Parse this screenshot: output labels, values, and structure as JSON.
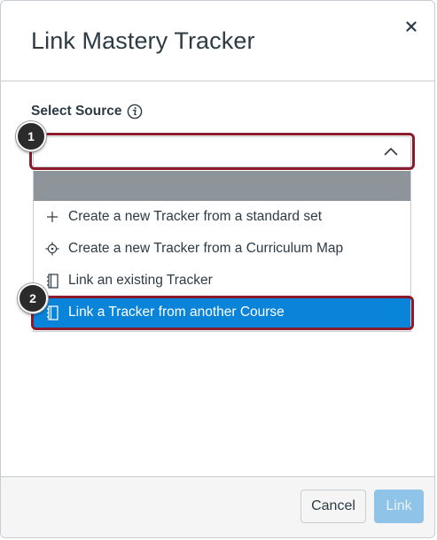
{
  "modal": {
    "title": "Link Mastery Tracker",
    "close_icon": "close-icon"
  },
  "form": {
    "select_label": "Select Source",
    "info_icon": "info-icon",
    "select_value": "",
    "chevron_icon": "chevron-up-icon"
  },
  "dropdown": {
    "options": [
      {
        "label": "Create a new Tracker from a standard set",
        "icon": "plus-icon",
        "selected": false
      },
      {
        "label": "Create a new Tracker from a Curriculum Map",
        "icon": "target-icon",
        "selected": false
      },
      {
        "label": "Link an existing Tracker",
        "icon": "notebook-icon",
        "selected": false
      },
      {
        "label": "Link a Tracker from another Course",
        "icon": "notebook-icon",
        "selected": true
      }
    ]
  },
  "callouts": [
    "1",
    "2"
  ],
  "footer": {
    "cancel_label": "Cancel",
    "link_label": "Link"
  },
  "colors": {
    "selected_bg": "#0a84d9",
    "highlight_border": "#8b1a2b",
    "link_button_disabled": "#8fc3e8"
  }
}
